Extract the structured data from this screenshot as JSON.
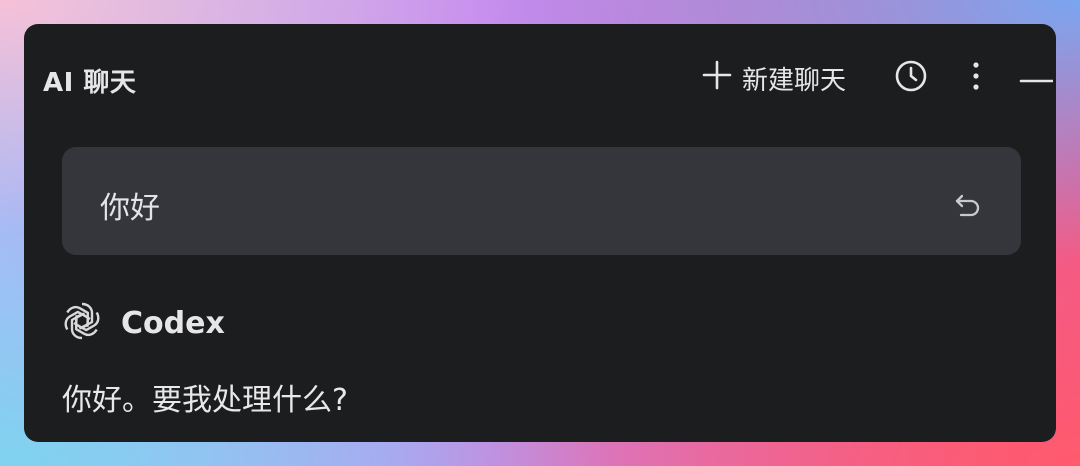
{
  "window": {
    "title": "AI 聊天",
    "new_chat_label": "新建聊天"
  },
  "icons": {
    "new_chat": "plus-icon",
    "history": "clock-icon",
    "more": "more-vertical-icon",
    "minimize": "minus-icon",
    "retry": "undo-icon",
    "assistant": "openai-logo-icon"
  },
  "conversation": {
    "user_message": "你好",
    "assistant_name": "Codex",
    "assistant_message": "你好。要我处理什么?"
  },
  "colors": {
    "window_bg": "#1c1d1f",
    "bubble_bg": "#35363c",
    "text": "#e8e8ea"
  }
}
